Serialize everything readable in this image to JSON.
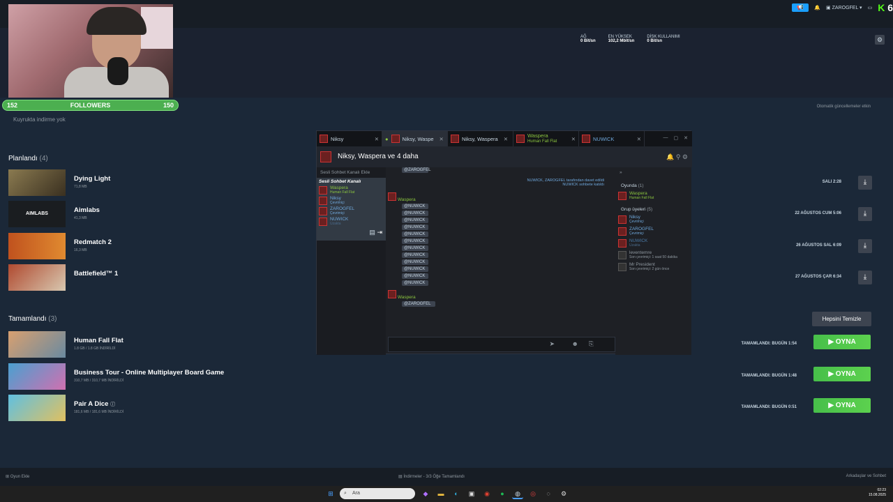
{
  "stream": {
    "followers_label": "FOLLOWERS",
    "followers_current": "152",
    "followers_goal": "150"
  },
  "topbar": {
    "username": "ZAROGFEL",
    "kick_badge_num": "6"
  },
  "net": {
    "net_label": "AĞ",
    "net_value": "0 Bit/sn",
    "peak_label": "EN YÜKSEK",
    "peak_value": "102,2 Mbit/sn",
    "disk_label": "DİSK KULLANIMI",
    "disk_value": "0 Bit/sn"
  },
  "downloads": {
    "auto_updates": "Otomatik güncellemeler etkin",
    "queue_empty": "Kuyrukta indirme yok",
    "planned_title": "Planlandı",
    "planned_count": "(4)",
    "completed_title": "Tamamlandı",
    "completed_count": "(3)",
    "clear_all": "Hepsini Temizle",
    "play_label": "OYNA",
    "planned": [
      {
        "name": "Dying Light",
        "size": "71,8 MB",
        "time": "SALI 2:28"
      },
      {
        "name": "Aimlabs",
        "size": "41,3 MB",
        "time": "22 AĞUSTOS CUM 5:06"
      },
      {
        "name": "Redmatch 2",
        "size": "16,3 MB",
        "time": "26 AĞUSTOS SAL 6:09"
      },
      {
        "name": "Battlefield™ 1",
        "size": "",
        "time": "27 AĞUSTOS ÇAR 6:34"
      }
    ],
    "completed": [
      {
        "name": "Human Fall Flat",
        "size": "1.8 GB / 1.8 GB İNDİRİLDİ",
        "status": "TAMAMLANDI: BUGÜN 1:54"
      },
      {
        "name": "Business Tour - Online Multiplayer Board Game",
        "size": "310,7 MB / 310,7 MB İNDİRİLDİ",
        "status": "TAMAMLANDI: BUGÜN 1:48"
      },
      {
        "name": "Pair A Dice",
        "size": "181,6 MB / 181,6 MB İNDİRİLDİ",
        "status": "TAMAMLANDI: BUGÜN 0:51"
      }
    ]
  },
  "chat": {
    "tabs": [
      "Niksy",
      "Niksy, Waspe",
      "Niksy, Waspera",
      "Waspera",
      "NUWICK"
    ],
    "tab_waspera_game": "Human Fall Flat",
    "header_title": "Niksy, Waspera ve 4 daha",
    "voice_add": "Sesli Sohbet Kanalı Ekle",
    "voice_channel": "Sesli Sohbet Kanalı",
    "voice_users": [
      {
        "name": "Waspera",
        "status": "Human Fall Flat"
      },
      {
        "name": "Niksy",
        "status": "Çevrimiçi"
      },
      {
        "name": "ZAROGFEL",
        "status": "Çevrimiçi"
      },
      {
        "name": "NUWICK",
        "status": "Uzakta"
      }
    ],
    "sys1": "NUWICK, ZAROGFEL tarafından davet edildi",
    "sys2": "NUWICK sohbete katıldı",
    "msg_author": "Waspera",
    "mention1": "@NUWICK",
    "mention2": "@ZAROGFEL",
    "top_mention": "@ZAROGFEL",
    "in_game_label": "Oyunda",
    "in_game_count": "(1)",
    "group_label": "Grup üyeleri",
    "group_count": "(5)",
    "in_game": [
      {
        "name": "Waspera",
        "status": "Human Fall Flat"
      }
    ],
    "members": [
      {
        "name": "Niksy",
        "status": "Çevrimiçi"
      },
      {
        "name": "ZAROGFEL",
        "status": "Çevrimiçi"
      },
      {
        "name": "NUWICK",
        "status": "Uzakta"
      },
      {
        "name": "leventemre",
        "status": "Son çevrimiçi: 1 saat 50 dakika"
      },
      {
        "name": "Mr President",
        "status": "Son çevrimiçi: 2 gün önce"
      }
    ]
  },
  "bottom": {
    "add_game": "Oyun Ekle",
    "downloads_status": "İndirmeler - 3/3 Öğe Tamamlandı",
    "friends_chat": "Arkadaşlar ve Sohbet"
  },
  "taskbar": {
    "search_placeholder": "Ara",
    "time": "02:23",
    "date": "15.08.2025"
  }
}
